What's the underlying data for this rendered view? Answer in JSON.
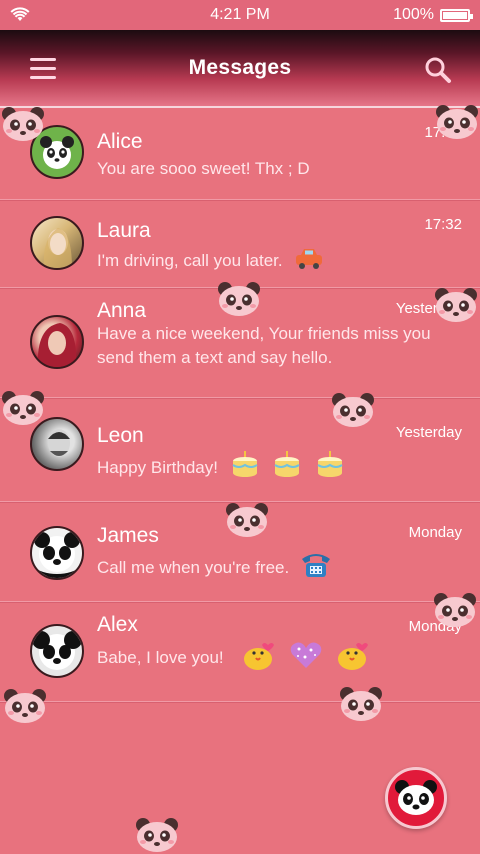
{
  "status_bar": {
    "time": "4:21 PM",
    "battery": "100%",
    "battery_level": 1.0,
    "wifi_icon": "wifi-icon"
  },
  "header": {
    "title": "Messages",
    "menu_icon": "hamburger-menu-icon",
    "search_icon": "search-icon"
  },
  "conversations": [
    {
      "name": "Alice",
      "message": "You are sooo sweet! Thx ; D",
      "time": "17:32",
      "emojis": []
    },
    {
      "name": "Laura",
      "message": "I'm driving, call you later.",
      "time": "17:32",
      "emojis": [
        "car-emoji"
      ]
    },
    {
      "name": "Anna",
      "message": "Have a nice weekend, Your friends miss you send them a text and say hello.",
      "time": "Yesterday",
      "emojis": []
    },
    {
      "name": "Leon",
      "message": "Happy Birthday!",
      "time": "Yesterday",
      "emojis": [
        "cake-emoji",
        "cake-emoji",
        "cake-emoji"
      ]
    },
    {
      "name": "James",
      "message": "Call me when you're free.",
      "time": "Monday",
      "emojis": [
        "telephone-emoji"
      ]
    },
    {
      "name": "Alex",
      "message": "Babe, I love you!",
      "time": "Monday",
      "emojis": [
        "kissing-chick-emoji",
        "sparkle-heart-emoji",
        "kissing-chick-emoji"
      ]
    }
  ],
  "compose_button": {
    "icon": "panda-icon"
  },
  "colors": {
    "background": "#e8727e",
    "header_dark": "#1c0b10",
    "fab": "#e11a3a"
  }
}
